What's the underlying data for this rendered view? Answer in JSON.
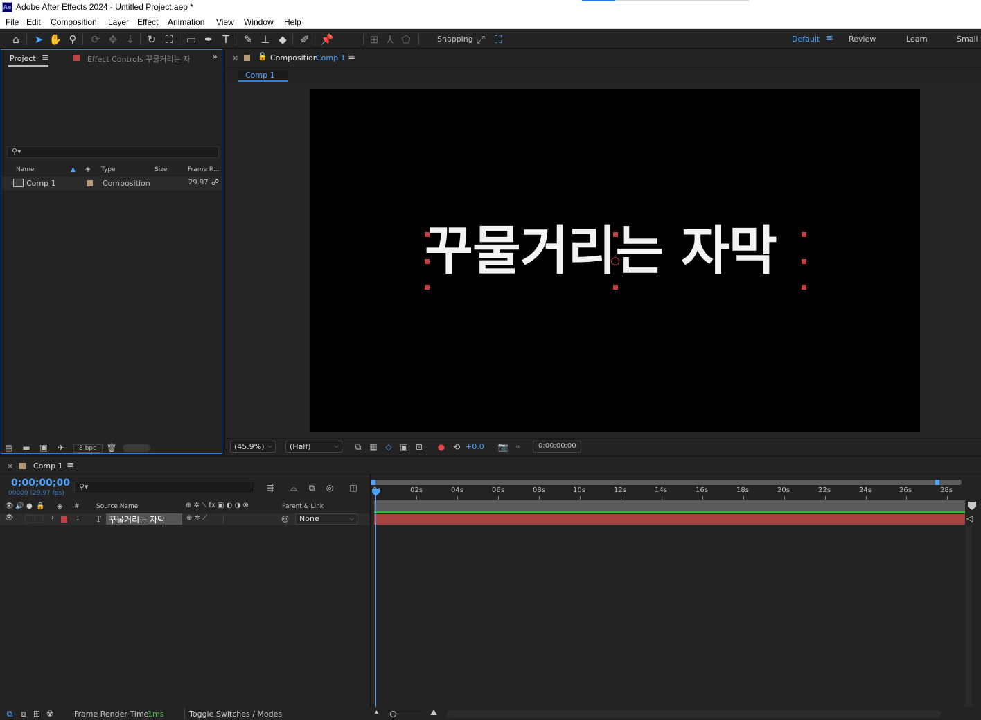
{
  "titlebar": {
    "logo": "Ae",
    "title": "Adobe After Effects 2024 - Untitled Project.aep *"
  },
  "menu": [
    "File",
    "Edit",
    "Composition",
    "Layer",
    "Effect",
    "Animation",
    "View",
    "Window",
    "Help"
  ],
  "toolbar": {
    "snapping_label": "Snapping",
    "workspaces": [
      "Default",
      "Review",
      "Learn",
      "Small S"
    ]
  },
  "project_panel": {
    "tab_project": "Project",
    "tab_effect_controls": "Effect Controls 꾸물거리는 자",
    "columns": [
      "Name",
      "Type",
      "Size",
      "Frame R..."
    ],
    "items": [
      {
        "name": "Comp 1",
        "type": "Composition",
        "size": "",
        "frame_rate": "29.97"
      }
    ],
    "bpc": "8 bpc"
  },
  "composition_panel": {
    "tab_label": "Composition",
    "comp_name": "Comp 1",
    "breadcrumb": "Comp 1",
    "canvas_text": "꾸물거리는 자막",
    "zoom": "(45.9%)",
    "resolution": "(Half)",
    "exposure": "+0.0",
    "timecode": "0;00;00;00"
  },
  "timeline_panel": {
    "tab_label": "Comp 1",
    "current_time": "0;00;00;00",
    "frame_info": "00000 (29.97 fps)",
    "columns": {
      "number": "#",
      "source_name": "Source Name",
      "parent_link": "Parent & Link"
    },
    "layers": [
      {
        "index": "1",
        "type_icon": "T",
        "name": "꾸물거리는 자막",
        "parent": "None"
      }
    ],
    "ruler": [
      "0s",
      "02s",
      "04s",
      "06s",
      "08s",
      "10s",
      "12s",
      "14s",
      "16s",
      "18s",
      "20s",
      "22s",
      "24s",
      "26s",
      "28s"
    ],
    "frame_render_label": "Frame Render Time:",
    "frame_render_value": "1ms",
    "toggle_label": "Toggle Switches / Modes"
  },
  "colors": {
    "accent_blue": "#2f8ff0",
    "label_red": "#c2403f",
    "label_tan": "#b59a78",
    "layer_bar": "#a8413f",
    "work_area_green": "#3fb33f"
  }
}
